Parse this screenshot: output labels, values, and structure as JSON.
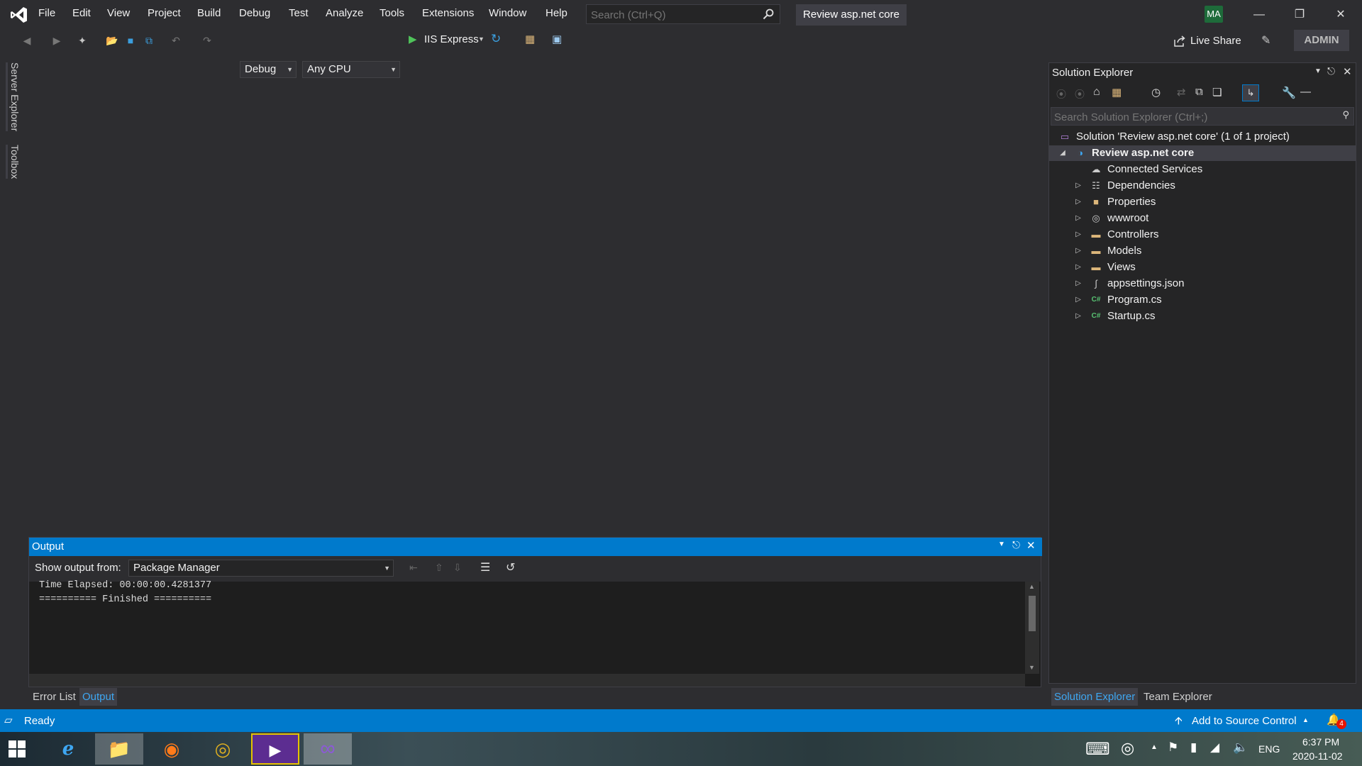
{
  "menu": [
    "File",
    "Edit",
    "View",
    "Project",
    "Build",
    "Debug",
    "Test",
    "Analyze",
    "Tools",
    "Extensions",
    "Window",
    "Help"
  ],
  "search": {
    "placeholder": "Search (Ctrl+Q)"
  },
  "solution_name": "Review asp.net core",
  "user_initials": "MA",
  "toolbar": {
    "config": "Debug",
    "platform": "Any CPU",
    "run_target": "IIS Express",
    "live_share": "Live Share",
    "admin": "ADMIN"
  },
  "left_tabs": [
    "Server Explorer",
    "Toolbox"
  ],
  "output": {
    "title": "Output",
    "show_from_label": "Show output from:",
    "source": "Package Manager",
    "lines": [
      "Time Elapsed: 00:00:00.4281377",
      "========== Finished =========="
    ]
  },
  "bottom_tabs_left": [
    {
      "label": "Error List",
      "active": false
    },
    {
      "label": "Output",
      "active": true
    }
  ],
  "solution_explorer": {
    "title": "Solution Explorer",
    "search_placeholder": "Search Solution Explorer (Ctrl+;)",
    "solution_line": "Solution 'Review asp.net core' (1 of 1 project)",
    "project": "Review asp.net core",
    "items": [
      {
        "label": "Connected Services",
        "icon": "connected-services-icon",
        "expandable": false
      },
      {
        "label": "Dependencies",
        "icon": "dependencies-icon",
        "expandable": true
      },
      {
        "label": "Properties",
        "icon": "properties-icon",
        "expandable": true
      },
      {
        "label": "wwwroot",
        "icon": "globe-icon",
        "expandable": true
      },
      {
        "label": "Controllers",
        "icon": "folder-icon",
        "expandable": true
      },
      {
        "label": "Models",
        "icon": "folder-icon",
        "expandable": true
      },
      {
        "label": "Views",
        "icon": "folder-icon",
        "expandable": true
      },
      {
        "label": "appsettings.json",
        "icon": "json-file-icon",
        "expandable": true
      },
      {
        "label": "Program.cs",
        "icon": "csharp-file-icon",
        "expandable": true
      },
      {
        "label": "Startup.cs",
        "icon": "csharp-file-icon",
        "expandable": true
      }
    ]
  },
  "bottom_tabs_right": [
    {
      "label": "Solution Explorer",
      "active": true
    },
    {
      "label": "Team Explorer",
      "active": false
    }
  ],
  "status": {
    "ready": "Ready",
    "source_control": "Add to Source Control",
    "notifications": "4"
  },
  "taskbar": {
    "language": "ENG",
    "time": "6:37 PM",
    "date": "2020-11-02"
  },
  "colors": {
    "accent": "#007acc",
    "background": "#2d2d30",
    "panel": "#252526"
  }
}
